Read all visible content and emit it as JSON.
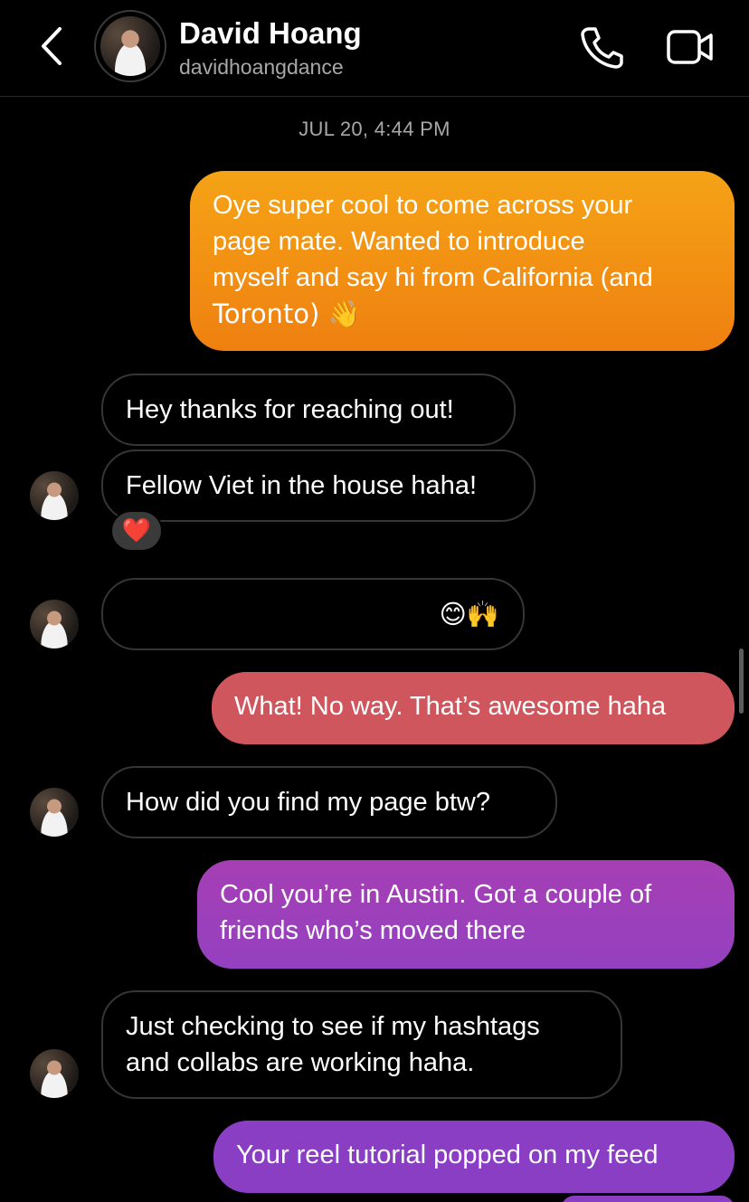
{
  "header": {
    "name": "David Hoang",
    "handle": "davidhoangdance"
  },
  "timestamp": "JUL 20, 4:44 PM",
  "messages": [
    {
      "from": "me",
      "text_lines": [
        "Oye super cool to come across your",
        "page mate. Wanted to introduce",
        "myself and say hi from California (and",
        "Toronto) 👋"
      ],
      "color": "#f08a10"
    },
    {
      "from": "them",
      "text": "Hey thanks for reaching out!"
    },
    {
      "from": "them",
      "text": "Fellow Viet in the house haha!",
      "reaction": "❤️"
    },
    {
      "from": "them",
      "text": "😊🙌"
    },
    {
      "from": "me",
      "text": "What! No way. That’s awesome haha",
      "color": "#d0565e"
    },
    {
      "from": "them",
      "text": "How did you find my page btw?"
    },
    {
      "from": "me",
      "text_lines": [
        "Cool you’re in Austin. Got a couple of",
        "friends who’s moved there"
      ],
      "color": "#9a3fb7"
    },
    {
      "from": "them",
      "text_lines": [
        "Just checking to see if my hashtags",
        "and collabs are working haha."
      ]
    },
    {
      "from": "me",
      "text": "Your reel tutorial popped on my feed",
      "color": "#8a3ec4"
    }
  ]
}
